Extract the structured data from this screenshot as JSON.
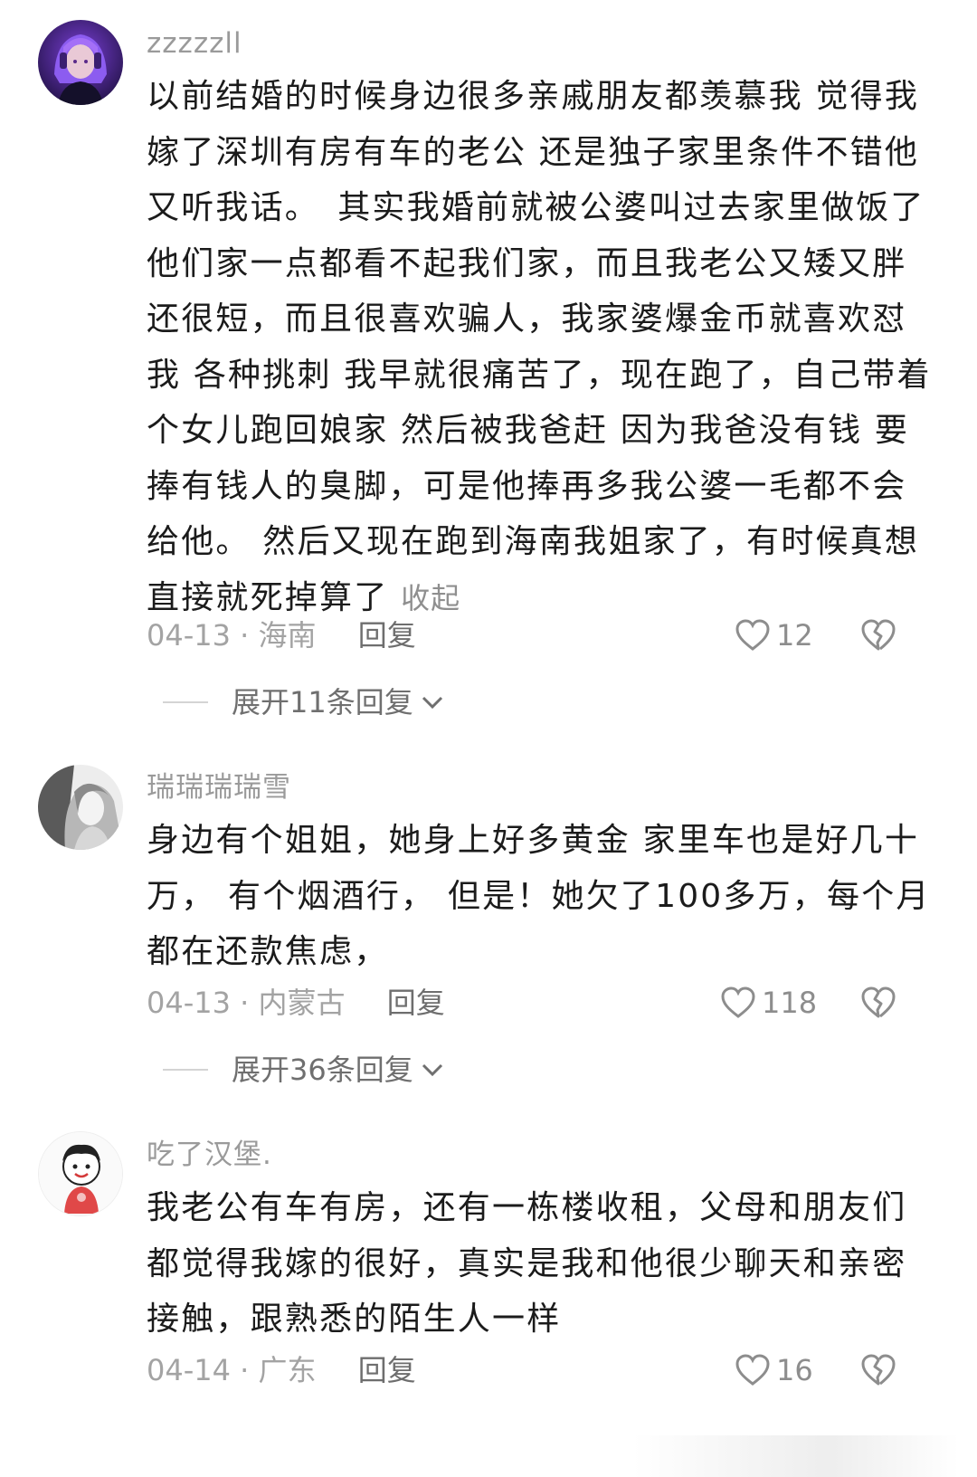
{
  "comments": [
    {
      "username": "zzzzzll",
      "text": "以前结婚的时候身边很多亲戚朋友都羡慕我 觉得我嫁了深圳有房有车的老公 还是独子家里条件不错他又听我话。　其实我婚前就被公婆叫过去家里做饭了 他们家一点都看不起我们家，而且我老公又矮又胖还很短，而且很喜欢骗人，我家婆爆金币就喜欢怼我 各种挑刺 我早就很痛苦了，现在跑了，自己带着个女儿跑回娘家 然后被我爸赶 因为我爸没有钱 要捧有钱人的臭脚，可是他捧再多我公婆一毛都不会给他。 然后又现在跑到海南我姐家了，有时候真想直接就死掉算了",
      "collapse_label": "收起",
      "date": "04-13",
      "location": "海南",
      "reply_label": "回复",
      "likes": "12",
      "expand_label": "展开11条回复"
    },
    {
      "username": "瑞瑞瑞瑞雪",
      "text": "身边有个姐姐，她身上好多黄金 家里车也是好几十万， 有个烟酒行， 但是！她欠了100多万，每个月都在还款焦虑，",
      "date": "04-13",
      "location": "内蒙古",
      "reply_label": "回复",
      "likes": "118",
      "expand_label": "展开36条回复"
    },
    {
      "username": "吃了汉堡.",
      "text": "我老公有车有房，还有一栋楼收租，父母和朋友们都觉得我嫁的很好，真实是我和他很少聊天和亲密接触，跟熟悉的陌生人一样",
      "date": "04-14",
      "location": "广东",
      "reply_label": "回复",
      "likes": "16"
    }
  ],
  "icons": {
    "like": "heart-outline-icon",
    "dislike": "broken-heart-icon",
    "expand": "chevron-down-icon"
  },
  "colors": {
    "text": "#1b1b1b",
    "username": "#9a9a9a",
    "meta": "#a3a3a3"
  }
}
